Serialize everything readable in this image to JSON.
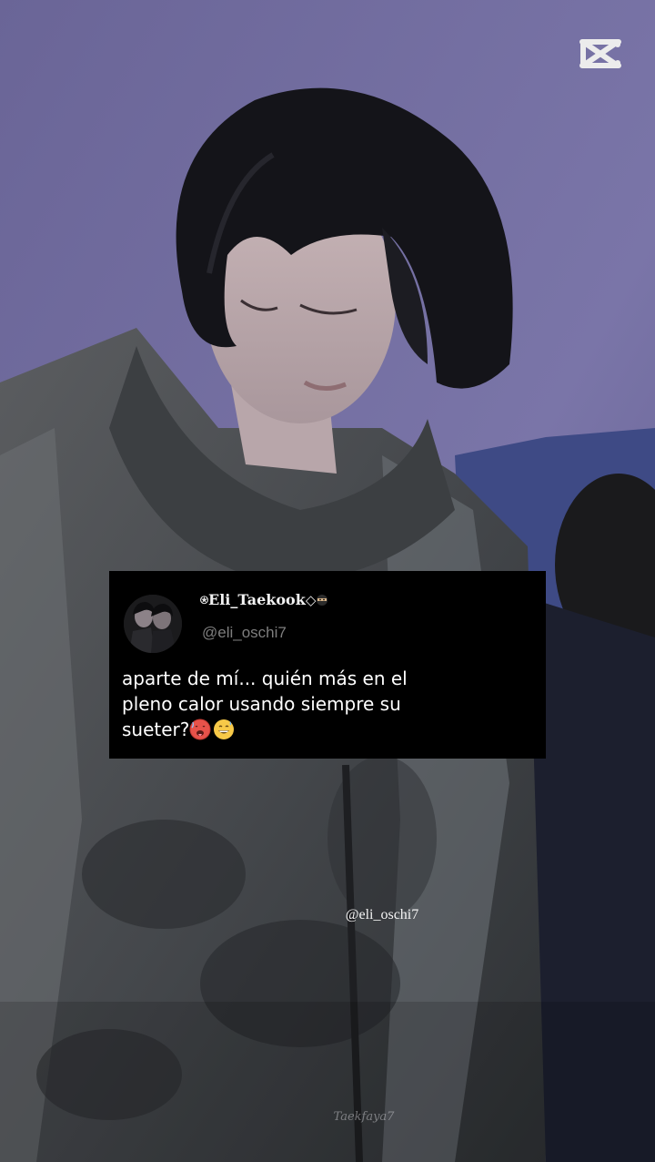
{
  "branding": {
    "app_logo_icon": "capcut-logo-icon"
  },
  "tweet": {
    "display_name": "Eli_Taekook",
    "name_prefix_icon": "star-circle-icon",
    "name_suffix_icons": [
      "diamond-icon",
      "ninja-emoji-icon"
    ],
    "name_prefix_glyph": "⍟",
    "name_suffix_glyph": "◇",
    "handle": "@eli_oschi7",
    "avatar_icon": "couple-photo-avatar",
    "text_lines": [
      "aparte de mí... quién más en el",
      "pleno calor usando siempre su",
      "sueter?"
    ],
    "emojis": [
      "hot-face-emoji",
      "grinning-sweat-emoji"
    ]
  },
  "overlay": {
    "handle_watermark": "@eli_oschi7",
    "signature_watermark": "Taekfaya7"
  },
  "colors": {
    "background": "#6f6a9c",
    "card_bg": "#000000",
    "text": "#ffffff",
    "handle_gray": "#7e7e7e"
  }
}
